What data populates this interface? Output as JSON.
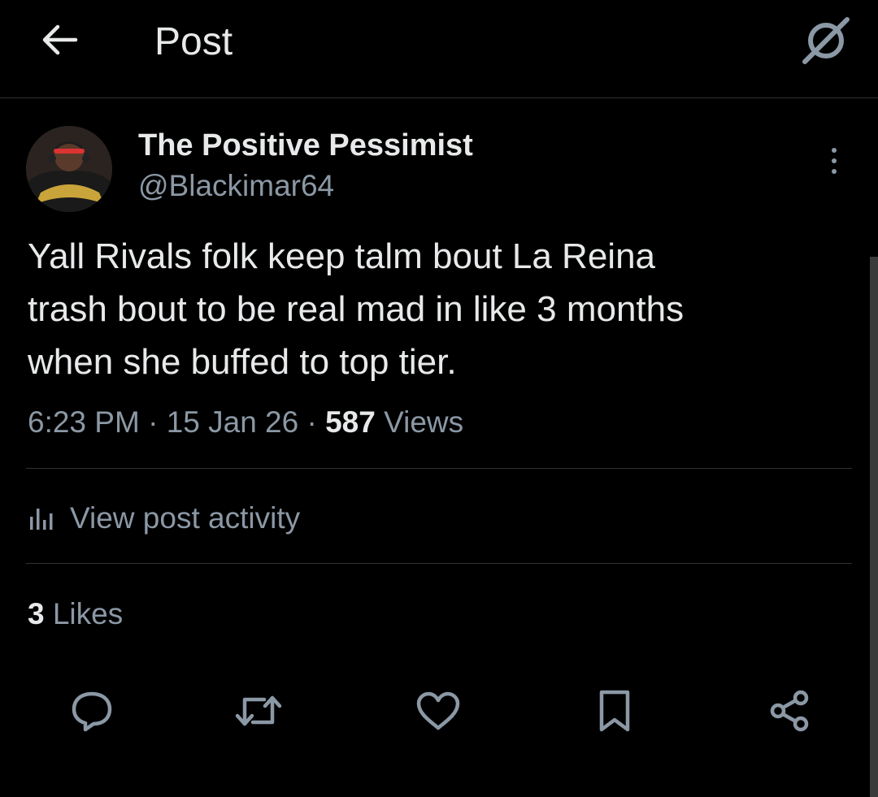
{
  "header": {
    "title": "Post",
    "back_icon": "arrow-left-icon",
    "grok_icon": "grok-icon"
  },
  "post": {
    "author": {
      "display_name": "The Positive Pessimist",
      "handle": "@Blackimar64"
    },
    "text": "Yall Rivals folk keep talm bout La Reina\ntrash bout to be real mad in like 3 months\nwhen she buffed to top tier.",
    "time": "6:23 PM",
    "date": "15 Jan 26",
    "separator": "·",
    "views_count": "587",
    "views_label": "Views",
    "activity_label": "View post activity",
    "likes_count": "3",
    "likes_label": "Likes"
  },
  "actions": [
    {
      "name": "reply",
      "icon": "reply-icon"
    },
    {
      "name": "repost",
      "icon": "repost-icon"
    },
    {
      "name": "like",
      "icon": "heart-icon"
    },
    {
      "name": "bookmark",
      "icon": "bookmark-icon"
    },
    {
      "name": "share",
      "icon": "share-icon"
    }
  ],
  "colors": {
    "background": "#000000",
    "primary_text": "#e7e9ea",
    "secondary_text": "#8b98a5",
    "divider": "#2f3336"
  }
}
